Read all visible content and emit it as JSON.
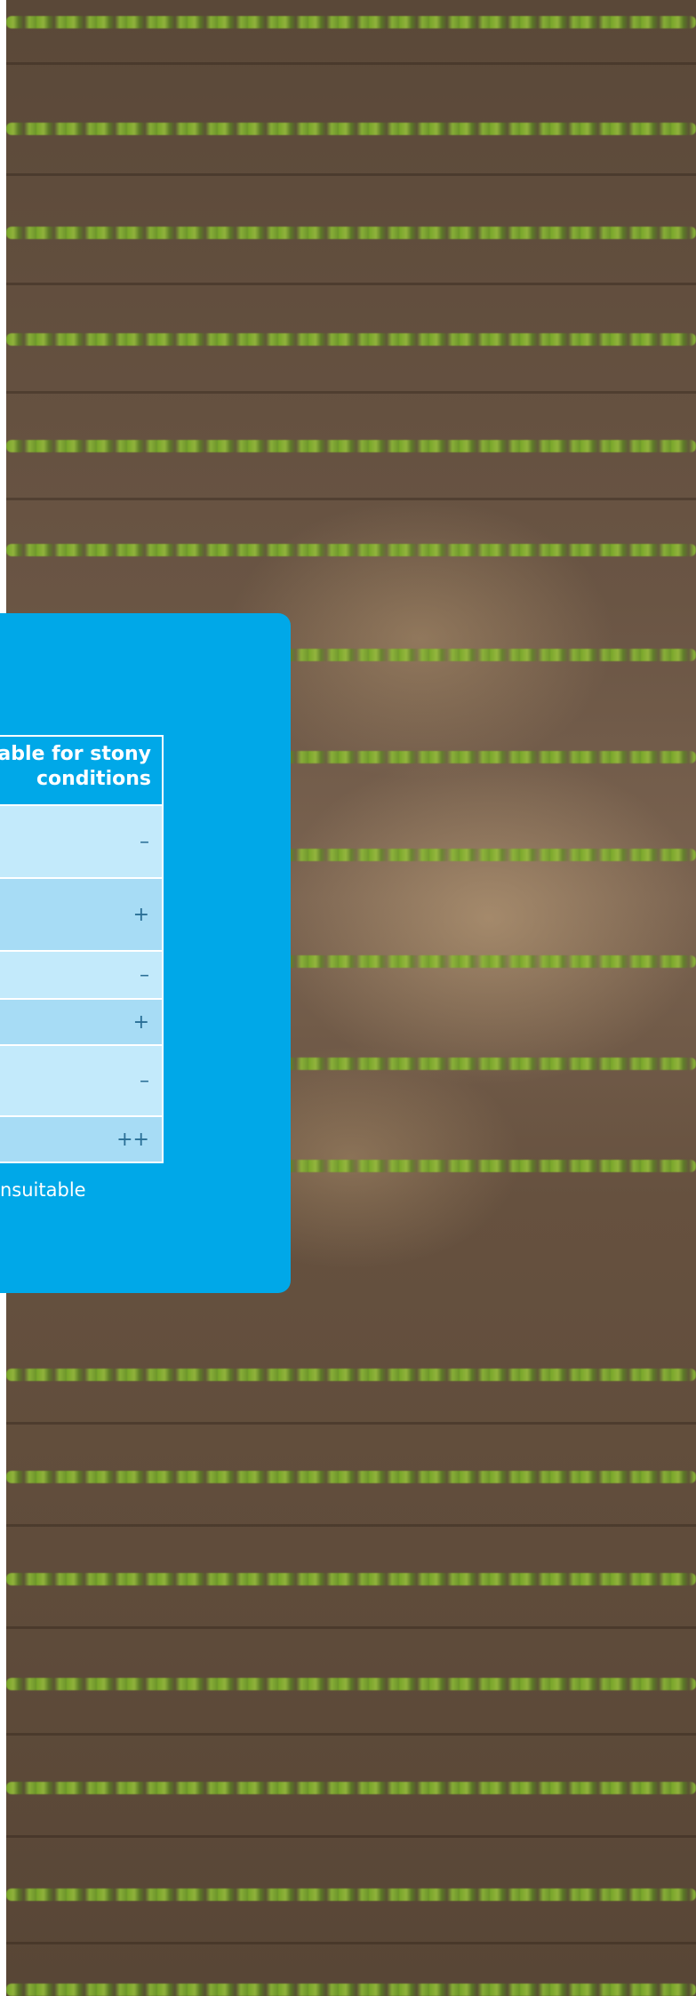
{
  "table": {
    "header": "able for stony conditions",
    "header_line1": "able for stony",
    "header_line2": "conditions",
    "rows": [
      "–",
      "+",
      "–",
      "+",
      "–",
      "++"
    ]
  },
  "footnote": "nsuitable",
  "colors": {
    "panel_blue": "#00a8e8",
    "row_light": "#c3eafb",
    "row_alt": "#a7dcf5",
    "symbol_text": "#2a6f96"
  }
}
